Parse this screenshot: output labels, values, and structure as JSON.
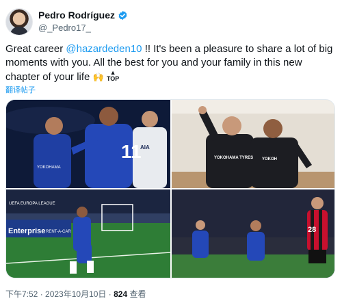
{
  "author": {
    "name": "Pedro Rodríguez",
    "handle": "@_Pedro17_"
  },
  "tweet": {
    "text_prefix": "Great career ",
    "mention": "@hazardeden10",
    "text_suffix": " !! It's been a pleasure to share a lot of big moments with you. All the best for you and your family in this new chapter of your life ",
    "emoji_hands": "🙌",
    "emoji_top": "TOP",
    "translate_label": "翻译帖子"
  },
  "media": {
    "photo1": {
      "jersey_number": "11",
      "sponsor": "YOKOHAMA",
      "kit_brand": "AIA"
    },
    "photo2": {
      "sponsor_left": "YOKOHAMA TYRES",
      "sponsor_right": "YOKOH"
    },
    "photo3": {
      "board_left": "UEFA EUROPA LEAGUE",
      "board_bottom": "Enterprise",
      "board_bottom2": "RENT-A-CAR"
    },
    "photo4": {
      "jersey_number": "28"
    }
  },
  "footer": {
    "time": "下午7:52",
    "sep1": " · ",
    "date": "2023年10月10日",
    "sep2": " · ",
    "views_count": "824",
    "views_label": " 查看"
  },
  "colors": {
    "accent": "#1d9bf0",
    "text": "#0f1419",
    "muted": "#536471",
    "chelsea_blue": "#1f3fa3"
  },
  "icons": [
    "verified-badge-icon",
    "more-options-icon"
  ]
}
